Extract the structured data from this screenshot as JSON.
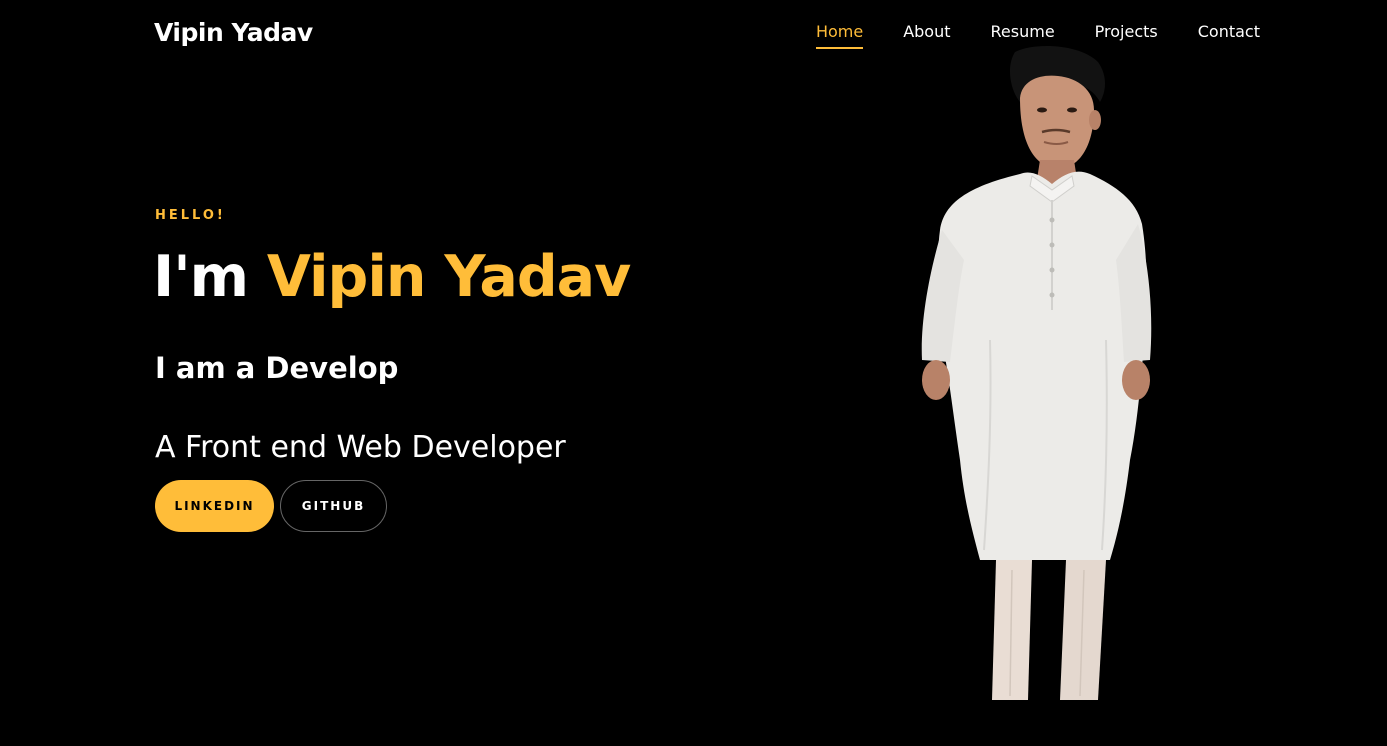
{
  "header": {
    "brand": "Vipin Yadav",
    "nav": [
      {
        "label": "Home",
        "active": true
      },
      {
        "label": "About",
        "active": false
      },
      {
        "label": "Resume",
        "active": false
      },
      {
        "label": "Projects",
        "active": false
      },
      {
        "label": "Contact",
        "active": false
      }
    ]
  },
  "hero": {
    "greeting": "HELLO!",
    "headline_prefix": "I'm ",
    "headline_name": "Vipin Yadav",
    "sub_headline": "I am a Develop",
    "tagline": "A Front end Web Developer",
    "buttons": {
      "linkedin": "LINKEDIN",
      "github": "GITHUB"
    },
    "portrait": "person-portrait-photo"
  },
  "colors": {
    "background": "#000000",
    "accent": "#ffbd39",
    "text": "#ffffff"
  }
}
